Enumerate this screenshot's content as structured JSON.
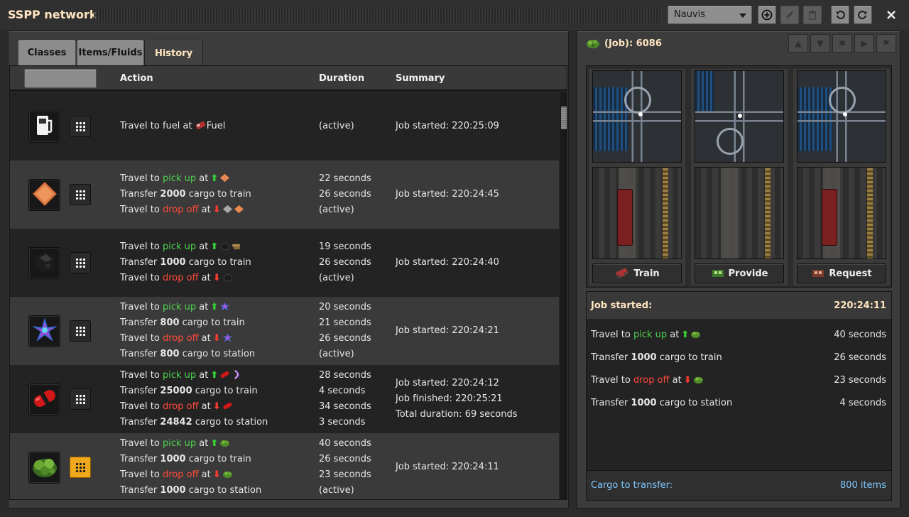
{
  "window": {
    "title": "SSPP network",
    "surface_selected": "Nauvis",
    "buttons": [
      "add-icon",
      "edit-icon",
      "trash-icon",
      "undo-icon",
      "redo-icon",
      "close-icon"
    ]
  },
  "tabs": [
    {
      "label": "Classes",
      "active": false
    },
    {
      "label": "Items/Fluids",
      "active": false
    },
    {
      "label": "History",
      "active": true
    }
  ],
  "table": {
    "headers": {
      "action": "Action",
      "duration": "Duration",
      "summary": "Summary"
    },
    "rows": [
      {
        "icon": "fuel-icon",
        "highlight": false,
        "actions": [
          {
            "pre": "Travel to fuel at ",
            "word": "",
            "post": "",
            "tail": "Fuel"
          }
        ],
        "durations": [
          "(active)"
        ],
        "summary": [
          "Job started: 220:25:09"
        ]
      },
      {
        "icon": "copper-plate-icon",
        "highlight": false,
        "actions": [
          {
            "pre": "Travel to ",
            "word": "pick up",
            "post": " at"
          },
          {
            "pre": "Transfer ",
            "num": "2000",
            "post": " cargo to train"
          },
          {
            "pre": "Travel to ",
            "word": "drop off",
            "post": " at"
          }
        ],
        "durations": [
          "22 seconds",
          "26 seconds",
          "(active)"
        ],
        "summary": [
          "Job started: 220:24:45"
        ]
      },
      {
        "icon": "coal-icon",
        "highlight": false,
        "actions": [
          {
            "pre": "Travel to ",
            "word": "pick up",
            "post": " at"
          },
          {
            "pre": "Transfer ",
            "num": "1000",
            "post": " cargo to train"
          },
          {
            "pre": "Travel to ",
            "word": "drop off",
            "post": " at"
          }
        ],
        "durations": [
          "19 seconds",
          "26 seconds",
          "(active)"
        ],
        "summary": [
          "Job started: 220:24:40"
        ]
      },
      {
        "icon": "crystal-icon",
        "highlight": false,
        "actions": [
          {
            "pre": "Travel to ",
            "word": "pick up",
            "post": " at"
          },
          {
            "pre": "Transfer ",
            "num": "800",
            "post": " cargo to train"
          },
          {
            "pre": "Travel to ",
            "word": "drop off",
            "post": " at"
          },
          {
            "pre": "Transfer ",
            "num": "800",
            "post": " cargo to station"
          }
        ],
        "durations": [
          "20 seconds",
          "21 seconds",
          "26 seconds",
          "(active)"
        ],
        "summary": [
          "Job started: 220:24:21"
        ]
      },
      {
        "icon": "capsule-icon",
        "highlight": false,
        "actions": [
          {
            "pre": "Travel to ",
            "word": "pick up",
            "post": " at"
          },
          {
            "pre": "Transfer ",
            "num": "25000",
            "post": " cargo to train"
          },
          {
            "pre": "Travel to ",
            "word": "drop off",
            "post": " at"
          },
          {
            "pre": "Transfer ",
            "num": "24842",
            "post": " cargo to station"
          }
        ],
        "durations": [
          "28 seconds",
          "4 seconds",
          "34 seconds",
          "3 seconds"
        ],
        "summary": [
          "Job started: 220:24:12",
          "Job finished: 220:25:21",
          "Total duration: 69 seconds"
        ]
      },
      {
        "icon": "moss-icon",
        "highlight": true,
        "actions": [
          {
            "pre": "Travel to ",
            "word": "pick up",
            "post": " at"
          },
          {
            "pre": "Transfer ",
            "num": "1000",
            "post": " cargo to train"
          },
          {
            "pre": "Travel to ",
            "word": "drop off",
            "post": " at"
          },
          {
            "pre": "Transfer ",
            "num": "1000",
            "post": " cargo to station"
          }
        ],
        "durations": [
          "40 seconds",
          "26 seconds",
          "23 seconds",
          "(active)"
        ],
        "summary": [
          "Job started: 220:24:11"
        ]
      }
    ]
  },
  "job": {
    "title": "(Job): 6086",
    "camera_buttons": {
      "train": "Train",
      "provide": "Provide",
      "request": "Request"
    },
    "started_label": "Job started:",
    "started_value": "220:24:11",
    "steps": [
      {
        "pre": "Travel to ",
        "word": "pick up",
        "post": " at",
        "dur": "40 seconds"
      },
      {
        "pre": "Transfer ",
        "num": "1000",
        "post": " cargo to train",
        "dur": "26 seconds"
      },
      {
        "pre": "Travel to ",
        "word": "drop off",
        "post": " at",
        "dur": "23 seconds"
      },
      {
        "pre": "Transfer ",
        "num": "1000",
        "post": " cargo to station",
        "dur": "4 seconds"
      }
    ],
    "cargo_label": "Cargo to transfer:",
    "cargo_value": "800 items"
  },
  "colors": {
    "pickup": "#4ed24e",
    "dropoff": "#ff4a3a",
    "accent": "#ffe6c0",
    "cargo": "#7fc8ff",
    "selected_grid": "#f0a81c"
  }
}
